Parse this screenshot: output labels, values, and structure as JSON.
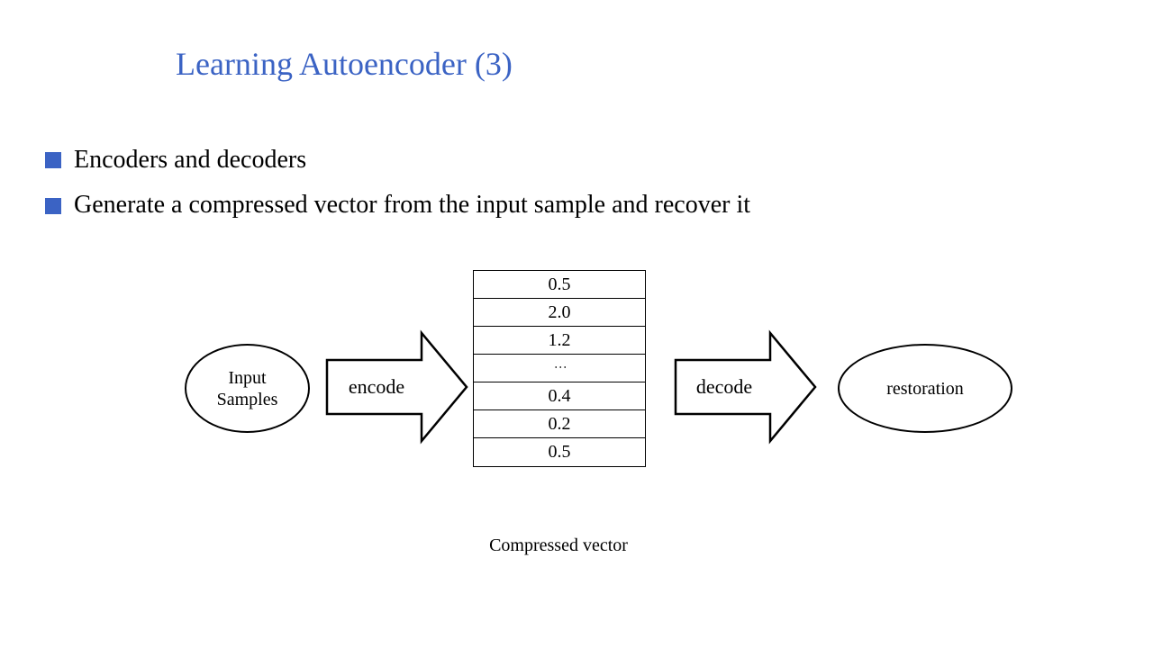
{
  "title": "Learning Autoencoder (3)",
  "bullets": [
    "Encoders and decoders",
    "Generate a compressed vector from the input sample and recover it"
  ],
  "diagram": {
    "input_label_line1": "Input",
    "input_label_line2": "Samples",
    "encode_label": "encode",
    "decode_label": "decode",
    "restoration_label": "restoration",
    "vector_caption": "Compressed vector",
    "vector_values": [
      "0.5",
      "2.0",
      "1.2",
      "⋮",
      "0.4",
      "0.2",
      "0.5"
    ]
  },
  "chart_data": {
    "type": "table",
    "title": "Compressed vector",
    "values": [
      "0.5",
      "2.0",
      "1.2",
      "…",
      "0.4",
      "0.2",
      "0.5"
    ]
  }
}
